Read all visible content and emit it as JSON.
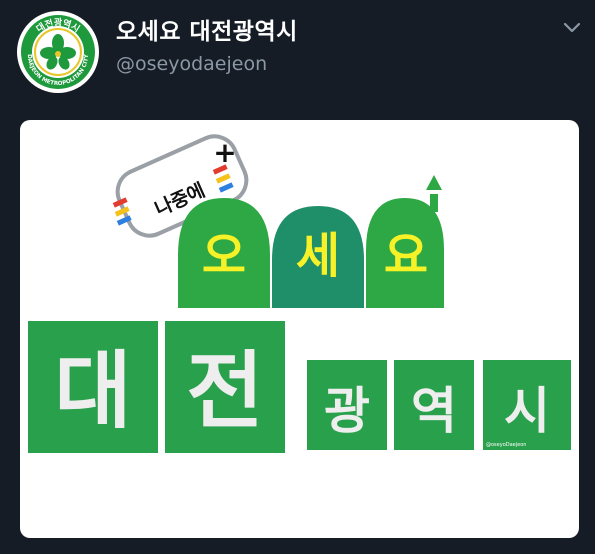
{
  "tweet": {
    "display_name": "오세요 대전광역시",
    "handle": "@oseyodaejeon",
    "avatar": {
      "seal_top_text": "대전광역시",
      "seal_ring_text": "DAEJEON METROPOLITAN CITY"
    },
    "menu_icon": "chevron-down-icon"
  },
  "image": {
    "bubble_text": "나중에",
    "bubble_plus": "+",
    "headline_chars": [
      "오",
      "세",
      "요"
    ],
    "big_chars": [
      "대",
      "전"
    ],
    "small_chars": [
      "광",
      "역",
      "시"
    ],
    "credit": "@oseyoDaejeon"
  },
  "colors": {
    "background": "#161c25",
    "name": "#ffffff",
    "handle": "#8b98a5",
    "tile_green": "#29a04b",
    "dome_green": "#2ea844",
    "headline_yellow": "#f7f227",
    "seal_green": "#1e9a3c"
  }
}
